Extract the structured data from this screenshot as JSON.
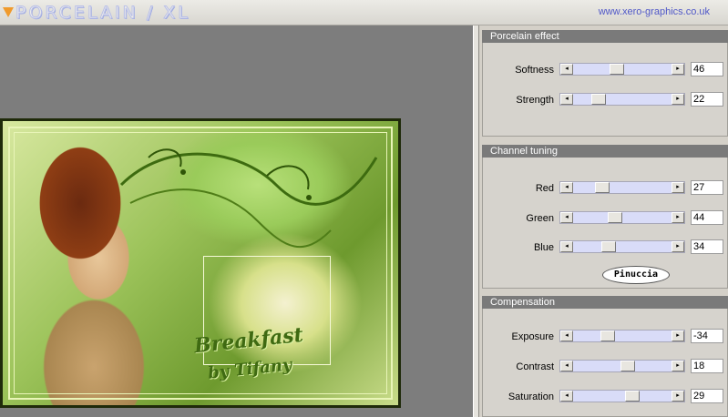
{
  "header": {
    "logo_text": "PORCELAIN / XL",
    "site_link": "www.xero-graphics.co.uk"
  },
  "preview": {
    "art_title": "Breakfast",
    "art_sub": "by Tifany"
  },
  "panel": {
    "porcelain": {
      "title": "Porcelain effect",
      "sliders": [
        {
          "label": "Softness",
          "value": "46"
        },
        {
          "label": "Strength",
          "value": "22"
        }
      ]
    },
    "channel": {
      "title": "Channel tuning",
      "sliders": [
        {
          "label": "Red",
          "value": "27"
        },
        {
          "label": "Green",
          "value": "44"
        },
        {
          "label": "Blue",
          "value": "34"
        }
      ],
      "badge": "Pinuccia"
    },
    "compensation": {
      "title": "Compensation",
      "sliders": [
        {
          "label": "Exposure",
          "value": "-34"
        },
        {
          "label": "Contrast",
          "value": "18"
        },
        {
          "label": "Saturation",
          "value": "29"
        }
      ]
    }
  },
  "colors": {
    "panel_bg": "#d4d0c8",
    "group_header": "#7a7a7a",
    "slider_track": "#d9dcf8",
    "link": "#5058c8",
    "logo_accent": "#f09a2c"
  }
}
